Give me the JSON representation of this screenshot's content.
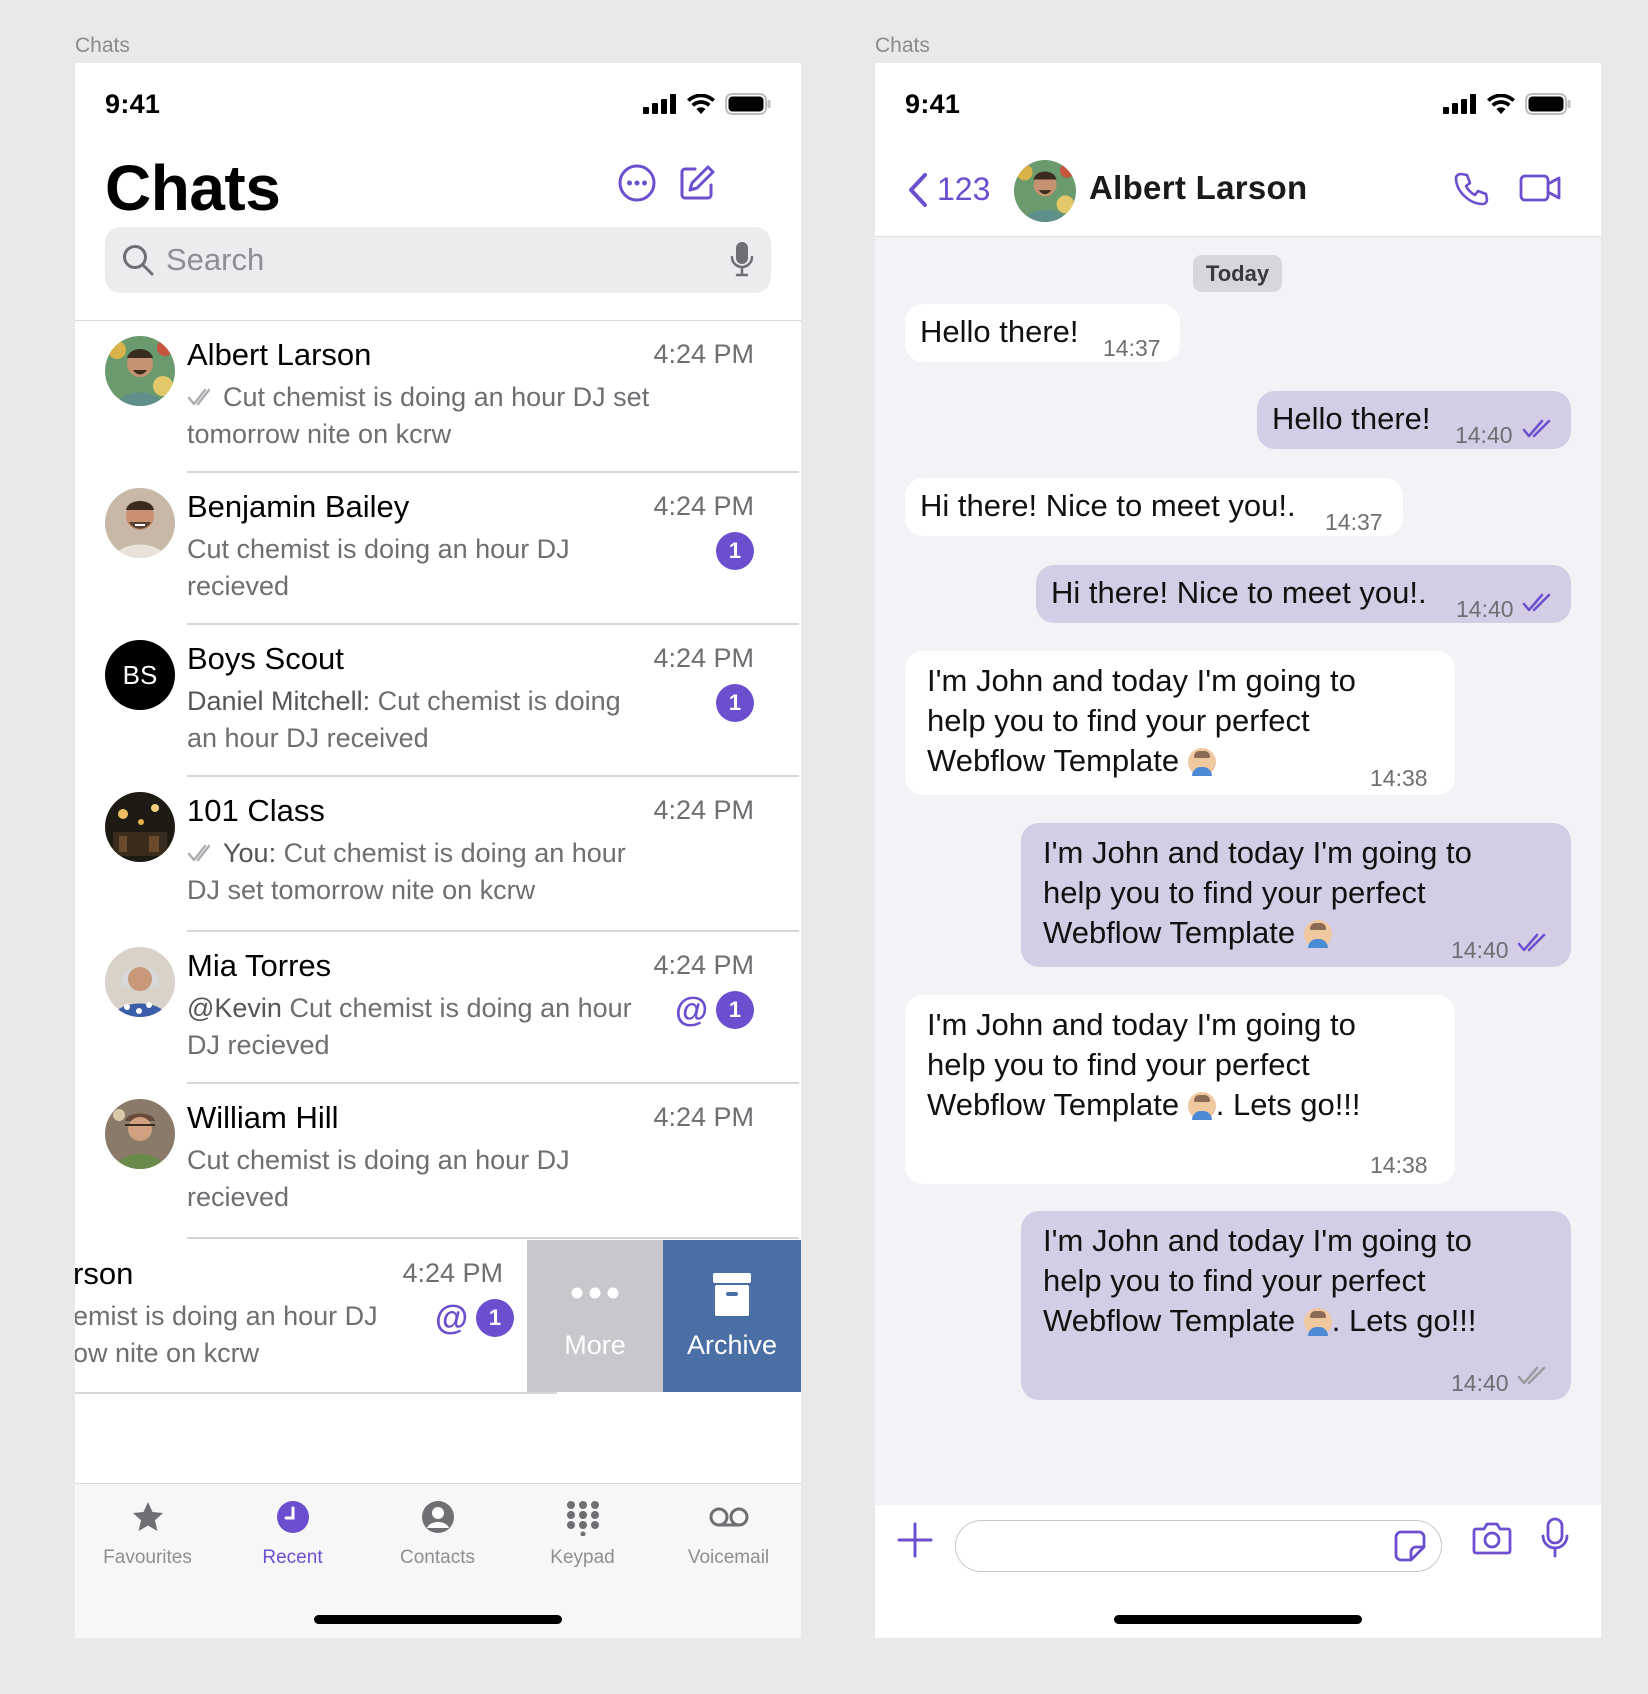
{
  "captions": {
    "left": "Chats",
    "right": "Chats"
  },
  "status": {
    "time": "9:41"
  },
  "chat_list": {
    "title": "Chats",
    "search_placeholder": "Search",
    "items": [
      {
        "name": "Albert Larson",
        "time": "4:24 PM",
        "sender": "",
        "preview": "Cut chemist is doing an hour DJ set tomorrow nite on kcrw",
        "read_tick": true,
        "mention": "",
        "badge": ""
      },
      {
        "name": "Benjamin Bailey",
        "time": "4:24 PM",
        "sender": "",
        "preview": "Cut chemist is doing an hour DJ recieved",
        "read_tick": false,
        "mention": "",
        "badge": "1"
      },
      {
        "name": "Boys Scout",
        "time": "4:24 PM",
        "sender": "Daniel Mitchell:",
        "preview": "Cut chemist is doing an hour DJ received",
        "read_tick": false,
        "mention": "",
        "badge": "1",
        "initials": "BS"
      },
      {
        "name": "101 Class",
        "time": "4:24 PM",
        "sender": "You:",
        "preview": "Cut chemist is doing an hour DJ set tomorrow nite on kcrw",
        "read_tick": true,
        "mention": "",
        "badge": ""
      },
      {
        "name": "Mia Torres",
        "time": "4:24 PM",
        "sender": "@Kevin",
        "preview": "Cut chemist is doing an hour DJ recieved",
        "read_tick": false,
        "mention": "@",
        "badge": "1"
      },
      {
        "name": "William Hill",
        "time": "4:24 PM",
        "sender": "",
        "preview": "Cut chemist is doing an hour DJ recieved",
        "read_tick": false,
        "mention": "",
        "badge": ""
      }
    ],
    "swiped_item": {
      "name": "rson",
      "time": "4:24 PM",
      "preview_line1": "emist is doing an hour DJ",
      "preview_line2": "ow nite on kcrw",
      "mention": "@",
      "badge": "1",
      "more_label": "More",
      "archive_label": "Archive"
    }
  },
  "tab_bar": {
    "tabs": [
      {
        "label": "Favourites",
        "icon": "star-icon",
        "active": false
      },
      {
        "label": "Recent",
        "icon": "clock-icon",
        "active": true
      },
      {
        "label": "Contacts",
        "icon": "person-icon",
        "active": false
      },
      {
        "label": "Keypad",
        "icon": "keypad-icon",
        "active": false
      },
      {
        "label": "Voicemail",
        "icon": "voicemail-icon",
        "active": false
      }
    ]
  },
  "conversation": {
    "back_label": "123",
    "contact_name": "Albert Larson",
    "date_label": "Today",
    "messages": [
      {
        "dir": "in",
        "text": "Hello there!",
        "time": "14:37"
      },
      {
        "dir": "out",
        "text": "Hello there!",
        "time": "14:40",
        "status": "read"
      },
      {
        "dir": "in",
        "text": "Hi there! Nice to meet you!.",
        "time": "14:37"
      },
      {
        "dir": "out",
        "text": "Hi there! Nice to meet you!.",
        "time": "14:40",
        "status": "read"
      },
      {
        "dir": "in",
        "lines": [
          "I'm John and today I'm going to",
          "help you to find your perfect",
          "Webflow Template"
        ],
        "emoji_after": "",
        "time": "14:38"
      },
      {
        "dir": "out",
        "lines": [
          "I'm John and today I'm going to",
          "help you to find your perfect",
          "Webflow Template"
        ],
        "emoji_after": "",
        "time": "14:40",
        "status": "read"
      },
      {
        "dir": "in",
        "lines": [
          "I'm John and today I'm going to",
          "help you to find your perfect",
          "Webflow Template"
        ],
        "emoji_after": ". Lets go!!!",
        "time": "14:38"
      },
      {
        "dir": "out",
        "lines": [
          "I'm John and today I'm going to",
          "help you to find your perfect",
          "Webflow Template"
        ],
        "emoji_after": ". Lets go!!!",
        "time": "14:40",
        "status": "delivered"
      }
    ]
  },
  "colors": {
    "accent": "#6b4fcf",
    "outgoing_bubble": "#d3cee6",
    "archive": "#4a6fa5",
    "more": "#c7c7cc"
  }
}
